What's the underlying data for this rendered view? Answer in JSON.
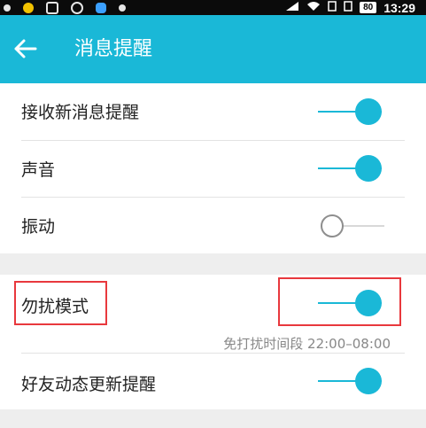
{
  "status_bar": {
    "time": "13:29",
    "battery": "80"
  },
  "header": {
    "title": "消息提醒"
  },
  "settings": {
    "receive_new": {
      "label": "接收新消息提醒",
      "enabled": true
    },
    "sound": {
      "label": "声音",
      "enabled": true
    },
    "vibrate": {
      "label": "振动",
      "enabled": false
    },
    "dnd": {
      "label": "勿扰模式",
      "enabled": true,
      "hint": "免打扰时间段 22:00–08:00"
    },
    "friend_updates": {
      "label": "好友动态更新提醒",
      "enabled": true
    }
  },
  "colors": {
    "accent": "#1ab8d7",
    "highlight": "#e8383d"
  }
}
